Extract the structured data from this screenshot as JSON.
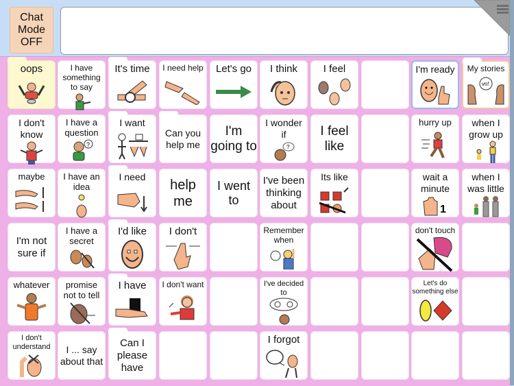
{
  "header": {
    "chat_mode_label": "Chat\nMode\nOFF",
    "message_text": "",
    "menu_icon": "hamburger-menu-icon"
  },
  "colors": {
    "grid_background": "#eeb0e6",
    "header_background": "#c6ddf5",
    "chat_button": "#f6d4b7",
    "highlight_yellow": "#fdf8cf",
    "ready_border": "#9bb9ef",
    "stories_border": "#f2c8a2"
  },
  "cells": [
    {
      "label": "oops",
      "symbol": "person-arms-up",
      "size": 15
    },
    {
      "label": "I have\nsomething\nto say",
      "symbol": "person-pointing",
      "size": 12
    },
    {
      "label": "It's time",
      "symbol": "watch",
      "size": 15
    },
    {
      "label": "I need help",
      "symbol": "helping-hands",
      "size": 12
    },
    {
      "label": "Let's go",
      "symbol": "green-arrow",
      "size": 15
    },
    {
      "label": "I think",
      "symbol": "thinking-head",
      "size": 15
    },
    {
      "label": "I feel",
      "symbol": "three-faces",
      "size": 15
    },
    {
      "label": "",
      "symbol": "",
      "size": 14
    },
    {
      "label": "I'm ready",
      "symbol": "smile-thumbs-up",
      "size": 14
    },
    {
      "label": "My stories",
      "symbol": "two-faces-talking",
      "size": 12
    },
    {
      "label": "I don't\nknow",
      "symbol": "person-shrug",
      "size": 14
    },
    {
      "label": "I have a\nquestion",
      "symbol": "person-question",
      "size": 13
    },
    {
      "label": "I want",
      "symbol": "want-hands",
      "size": 14
    },
    {
      "label": "Can you\nhelp me",
      "symbol": "",
      "size": 14
    },
    {
      "label": "I'm\ngoing to",
      "symbol": "",
      "size": 19
    },
    {
      "label": "I wonder\nif",
      "symbol": "wonder-head",
      "size": 14
    },
    {
      "label": "I feel\nlike",
      "symbol": "",
      "size": 19
    },
    {
      "label": "",
      "symbol": "",
      "size": 14
    },
    {
      "label": "hurry up",
      "symbol": "running-person",
      "size": 13
    },
    {
      "label": "when I\ngrow up",
      "symbol": "child-adult",
      "size": 14
    },
    {
      "label": "maybe",
      "symbol": "balance-hands",
      "size": 13
    },
    {
      "label": "I have an\nidea",
      "symbol": "lightbulb-face",
      "size": 13
    },
    {
      "label": "I need",
      "symbol": "pointing-hand-down",
      "size": 14
    },
    {
      "label": "help\nme",
      "symbol": "",
      "size": 20
    },
    {
      "label": "I went\nto",
      "symbol": "",
      "size": 18
    },
    {
      "label": "I've been\nthinking\nabout",
      "symbol": "",
      "size": 15
    },
    {
      "label": "Its like",
      "symbol": "squares-like",
      "size": 14
    },
    {
      "label": "",
      "symbol": "",
      "size": 14
    },
    {
      "label": "wait a\nminute",
      "symbol": "hand-one",
      "size": 14
    },
    {
      "label": "when I\nwas little",
      "symbol": "family-group",
      "size": 14
    },
    {
      "label": "I'm not\nsure if",
      "symbol": "",
      "size": 15
    },
    {
      "label": "I have a\nsecret",
      "symbol": "secret-faces",
      "size": 13
    },
    {
      "label": "I'd like",
      "symbol": "smile-face",
      "size": 15
    },
    {
      "label": "I don't",
      "symbol": "finger-no",
      "size": 15
    },
    {
      "label": "",
      "symbol": "",
      "size": 14
    },
    {
      "label": "Remember\nwhen",
      "symbol": "remember-girl",
      "size": 12
    },
    {
      "label": "",
      "symbol": "",
      "size": 14
    },
    {
      "label": "",
      "symbol": "",
      "size": 14
    },
    {
      "label": "don't touch",
      "symbol": "no-touch",
      "size": 12
    },
    {
      "label": "",
      "symbol": "",
      "size": 14
    },
    {
      "label": "whatever",
      "symbol": "person-shrug-orange",
      "size": 13
    },
    {
      "label": "promise\nnot to tell",
      "symbol": "no-tell-face",
      "size": 13
    },
    {
      "label": "I have",
      "symbol": "hand-holding-box",
      "size": 15
    },
    {
      "label": "I don't want",
      "symbol": "girl-refusing",
      "size": 12
    },
    {
      "label": "",
      "symbol": "",
      "size": 14
    },
    {
      "label": "I've decided\nto",
      "symbol": "decide-head",
      "size": 11
    },
    {
      "label": "",
      "symbol": "",
      "size": 14
    },
    {
      "label": "",
      "symbol": "",
      "size": 14
    },
    {
      "label": "Let's do\nsomething else",
      "symbol": "oval-diamond",
      "size": 10
    },
    {
      "label": "",
      "symbol": "",
      "size": 14
    },
    {
      "label": "I don't\nunderstand",
      "symbol": "confused-face",
      "size": 11
    },
    {
      "label": "I ... say\nabout that",
      "symbol": "",
      "size": 14
    },
    {
      "label": "Can I\nplease\nhave",
      "symbol": "",
      "size": 15
    },
    {
      "label": "",
      "symbol": "",
      "size": 14
    },
    {
      "label": "",
      "symbol": "",
      "size": 14
    },
    {
      "label": "I forgot",
      "symbol": "forgot-person",
      "size": 15
    },
    {
      "label": "",
      "symbol": "",
      "size": 14
    },
    {
      "label": "",
      "symbol": "",
      "size": 14
    },
    {
      "label": "",
      "symbol": "",
      "size": 14
    },
    {
      "label": "",
      "symbol": "",
      "size": 14
    }
  ]
}
